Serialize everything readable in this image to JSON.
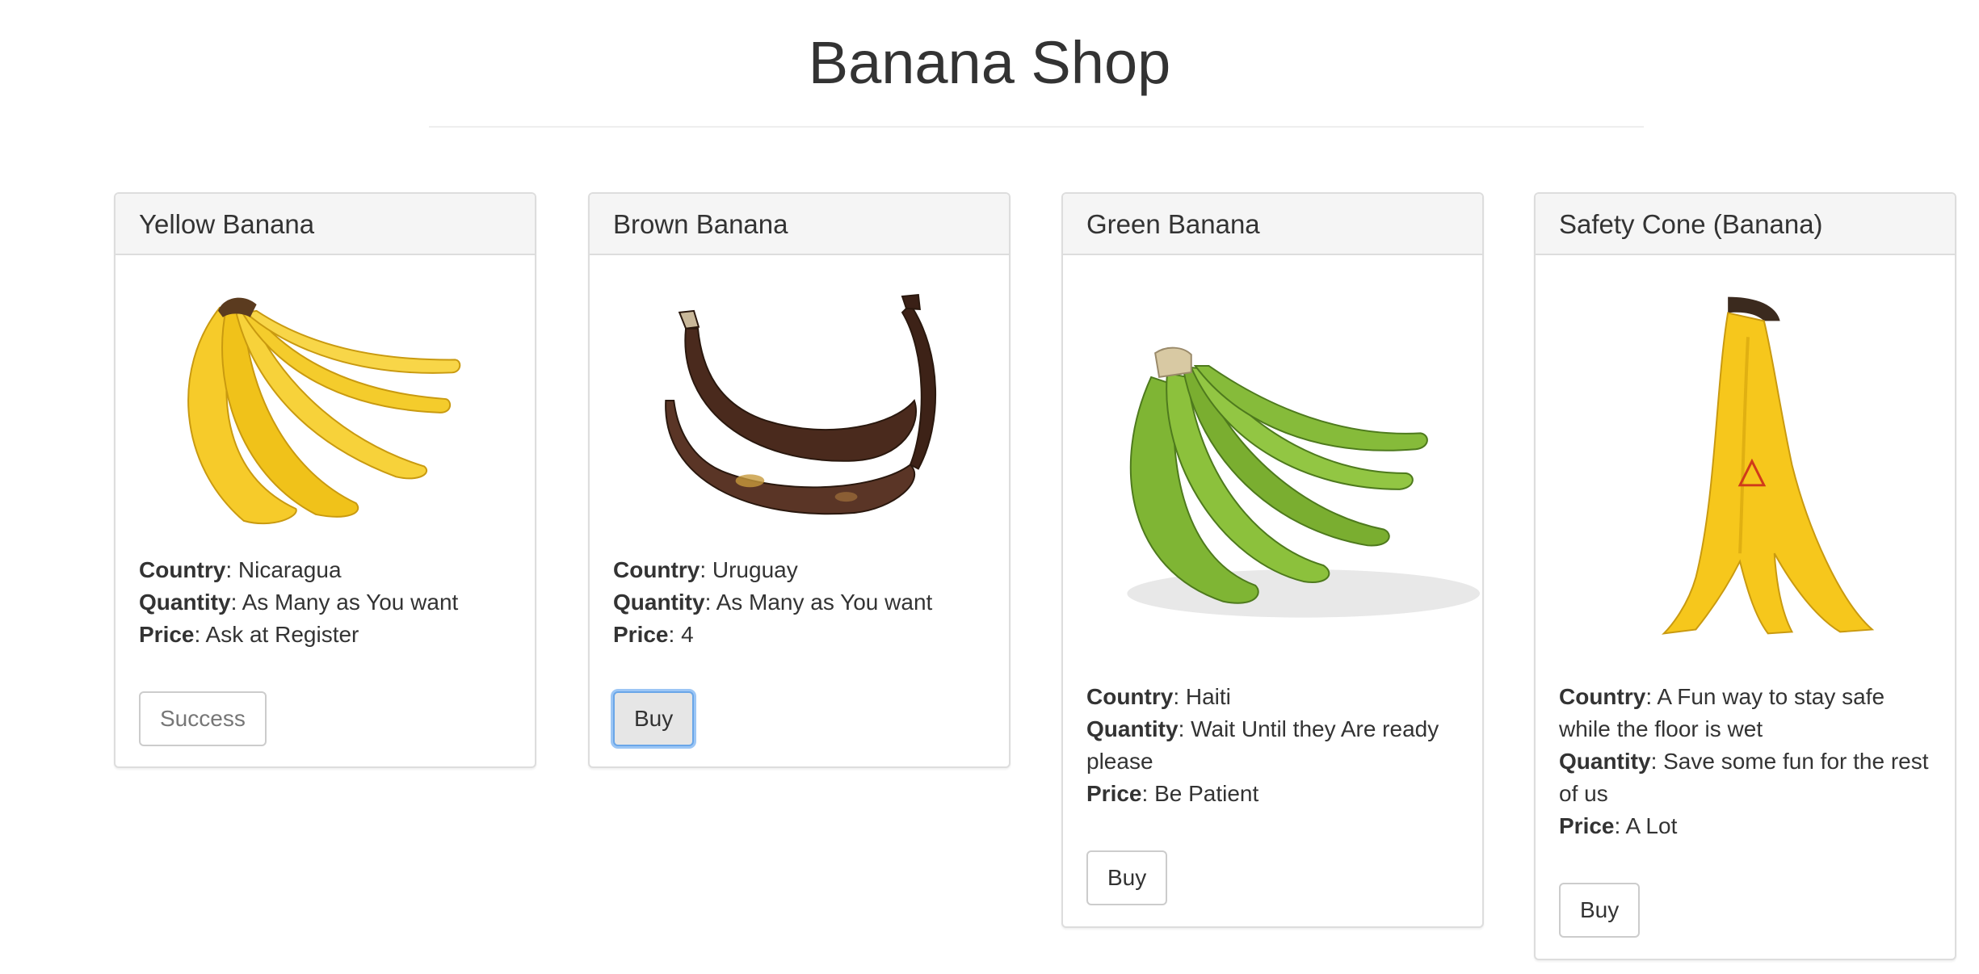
{
  "page": {
    "title": "Banana Shop"
  },
  "labels": {
    "country": "Country",
    "quantity": "Quantity",
    "price": "Price"
  },
  "products": [
    {
      "name": "Yellow Banana",
      "image_icon": "yellow-banana-image",
      "country": "Nicaragua",
      "quantity": "As Many as You want",
      "price": "Ask at Register",
      "button_label": "Success",
      "button_state": "success"
    },
    {
      "name": "Brown Banana",
      "image_icon": "brown-banana-image",
      "country": "Uruguay",
      "quantity": "As Many as You want",
      "price": "4",
      "button_label": "Buy",
      "button_state": "focused"
    },
    {
      "name": "Green Banana",
      "image_icon": "green-banana-image",
      "country": "Haiti",
      "quantity": "Wait Until they Are ready please",
      "price": "Be Patient",
      "button_label": "Buy",
      "button_state": "default"
    },
    {
      "name": "Safety Cone (Banana)",
      "image_icon": "banana-safety-cone-image",
      "country": "A Fun way to stay safe while the floor is wet",
      "quantity": "Save some fun for the rest of us",
      "price": "A Lot",
      "button_label": "Buy",
      "button_state": "default"
    }
  ]
}
